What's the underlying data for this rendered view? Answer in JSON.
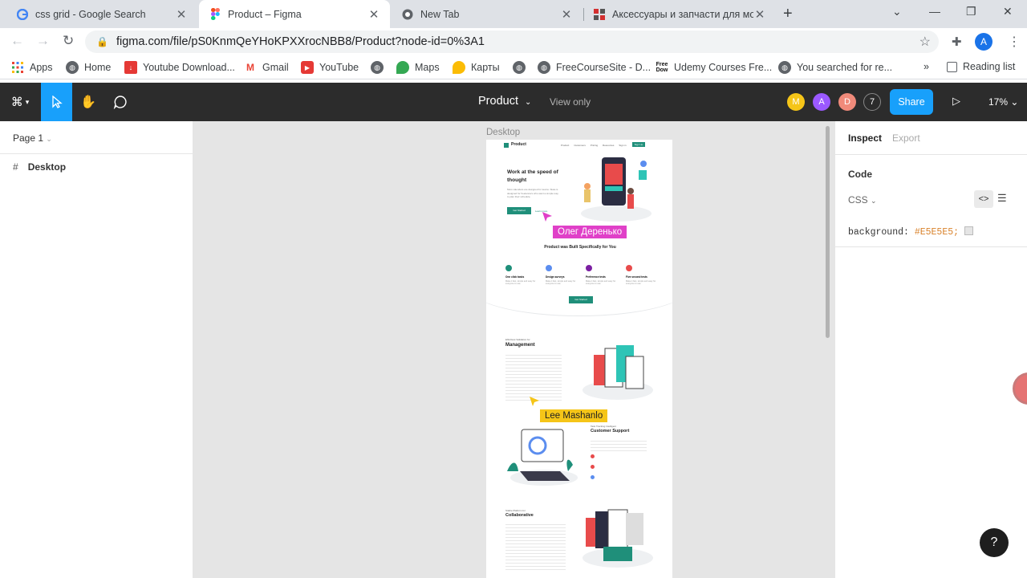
{
  "browser": {
    "tabs": [
      {
        "title": "css grid - Google Search",
        "icon": "google-icon"
      },
      {
        "title": "Product – Figma",
        "icon": "figma-icon"
      },
      {
        "title": "New Tab",
        "icon": "chrome-icon"
      },
      {
        "title": "Аксессуары и запчасти для моб",
        "icon": "shop-icon"
      }
    ],
    "url": "figma.com/file/pS0KnmQeYHoKPXXrocNBB8/Product?node-id=0%3A1",
    "profile_initial": "A",
    "bookmarks": [
      {
        "label": "Apps",
        "icon": "apps-grid-icon"
      },
      {
        "label": "Home",
        "icon": "globe-icon"
      },
      {
        "label": "Youtube Download...",
        "icon": "download-icon"
      },
      {
        "label": "Gmail",
        "icon": "gmail-icon"
      },
      {
        "label": "YouTube",
        "icon": "youtube-icon"
      },
      {
        "label": "",
        "icon": "globe-icon"
      },
      {
        "label": "Maps",
        "icon": "maps-pin-icon"
      },
      {
        "label": "Карты",
        "icon": "maps-pin-icon"
      },
      {
        "label": "",
        "icon": "globe-icon"
      },
      {
        "label": "FreeCourseSite - D...",
        "icon": "globe-icon"
      },
      {
        "label": "Udemy Courses Fre...",
        "icon": "freedow-icon"
      },
      {
        "label": "You searched for re...",
        "icon": "globe-icon"
      }
    ],
    "overflow": "»",
    "reading_list": "Reading list"
  },
  "figma": {
    "file_title": "Product",
    "view_mode": "View only",
    "avatars": [
      {
        "initial": "M",
        "color": "#f5c518"
      },
      {
        "initial": "A",
        "color": "#9b59ff"
      },
      {
        "initial": "D",
        "color": "#f08a7a"
      }
    ],
    "viewer_count": "7",
    "share": "Share",
    "zoom": "17%",
    "page": "Page 1",
    "layers": [
      {
        "name": "Desktop"
      }
    ],
    "frame_label": "Desktop",
    "inspect_tab": "Inspect",
    "export_tab": "Export",
    "code_heading": "Code",
    "lang": "CSS",
    "css_property": "background:",
    "css_value": "#E5E5E5;",
    "help": "?"
  },
  "artboard": {
    "logo": "Product",
    "nav": [
      "Product",
      "Customers",
      "Pricing",
      "Resources",
      "Sign in"
    ],
    "cta": "Sign Up",
    "hero_title": "Work at the speed of thought",
    "hero_text": "Most calendars are designed for teams. Slate is designed for freelancers who want a simple way to plan their schedule.",
    "hero_button": "Get Started",
    "hero_link": "Learn more",
    "section_title": "Product  was Built Specifically for You",
    "features": [
      {
        "title": "One click tasks",
        "color": "#1f8f7a"
      },
      {
        "title": "Design surveys",
        "color": "#5b8def"
      },
      {
        "title": "Preference tests",
        "color": "#7b1fa2"
      },
      {
        "title": "Five second tests",
        "color": "#e84b4b"
      }
    ],
    "feature_text": "Make it fast, simple and easy for everyone to use.",
    "mid_button": "Get Started",
    "management_kicker": "Effortless Validation for",
    "management_title": "Management",
    "support_kicker": "Task Tracking Intelligent",
    "support_title": "Customer Support",
    "collab_kicker": "Stable Platform for",
    "collab_title": "Collaborative"
  },
  "cursors": [
    {
      "name": "Олег Деренько",
      "color": "#e040c8"
    },
    {
      "name": "Lee Mashanlo",
      "color": "#f5c518"
    }
  ]
}
